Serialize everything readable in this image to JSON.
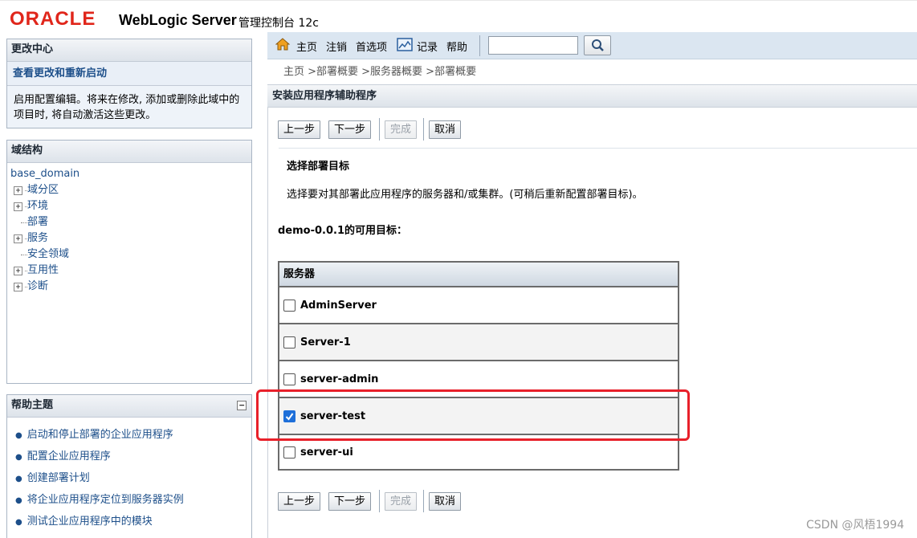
{
  "header": {
    "oracle_logo": "ORACLE",
    "product_name": "WebLogic Server",
    "product_sub": "管理控制台 12c",
    "brand_color": "#e0261b"
  },
  "change_center": {
    "title": "更改中心",
    "link": "查看更改和重新启动",
    "description": "启用配置编辑。将来在修改, 添加或删除此域中的项目时, 将自动激活这些更改。"
  },
  "domain_structure": {
    "title": "域结构",
    "root": "base_domain",
    "items": [
      {
        "label": "域分区",
        "expandable": true
      },
      {
        "label": "环境",
        "expandable": true
      },
      {
        "label": "部署",
        "expandable": false
      },
      {
        "label": "服务",
        "expandable": true
      },
      {
        "label": "安全领域",
        "expandable": false
      },
      {
        "label": "互用性",
        "expandable": true
      },
      {
        "label": "诊断",
        "expandable": true
      }
    ]
  },
  "help_topics": {
    "title": "帮助主题",
    "collapse_symbol": "−",
    "items": [
      "启动和停止部署的企业应用程序",
      "配置企业应用程序",
      "创建部署计划",
      "将企业应用程序定位到服务器实例",
      "测试企业应用程序中的模块"
    ]
  },
  "toolbar": {
    "home": "主页",
    "logout": "注销",
    "preferences": "首选项",
    "record": "记录",
    "help": "帮助",
    "search_value": ""
  },
  "breadcrumb": "主页 >部署概要 >服务器概要 >部署概要",
  "content": {
    "title": "安装应用程序辅助程序",
    "buttons": {
      "back": "上一步",
      "next": "下一步",
      "finish": "完成",
      "cancel": "取消"
    },
    "section_title": "选择部署目标",
    "section_description": "选择要对其部署此应用程序的服务器和/或集群。(可稍后重新配置部署目标)。",
    "targets_label": "demo-0.0.1的可用目标：",
    "table_header": "服务器",
    "servers": [
      {
        "name": "AdminServer",
        "checked": false
      },
      {
        "name": "Server-1",
        "checked": false
      },
      {
        "name": "server-admin",
        "checked": false
      },
      {
        "name": "server-test",
        "checked": true
      },
      {
        "name": "server-ui",
        "checked": false
      }
    ]
  },
  "watermark": "CSDN @风梧1994",
  "colors": {
    "accent_blue": "#1d4f8a",
    "toolbar_bg": "#dbe6f1",
    "highlight_red": "#e8202a",
    "checkbox_blue": "#1e6fd9"
  }
}
